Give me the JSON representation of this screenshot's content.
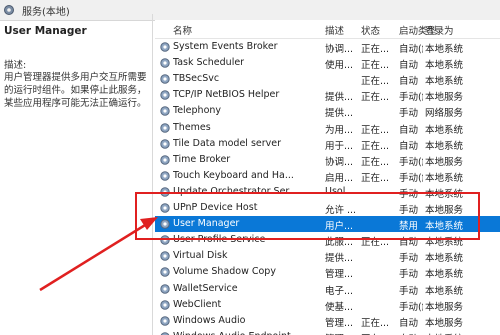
{
  "window": {
    "title": "服务(本地)"
  },
  "details": {
    "service_name": "User Manager",
    "description_label": "描述:",
    "description": "用户管理器提供多用户交互所需要的运行时组件。如果停止此服务，某些应用程序可能无法正确运行。"
  },
  "table": {
    "columns": [
      "名称",
      "描述",
      "状态",
      "启动类型",
      "登录为"
    ],
    "rows": [
      {
        "name": "System Events Broker",
        "desc": "协调...",
        "status": "正在...",
        "start": "自动(触发...",
        "logon": "本地系统"
      },
      {
        "name": "Task Scheduler",
        "desc": "使用...",
        "status": "正在...",
        "start": "自动",
        "logon": "本地系统"
      },
      {
        "name": "TBSecSvc",
        "desc": "",
        "status": "正在...",
        "start": "自动",
        "logon": "本地系统"
      },
      {
        "name": "TCP/IP NetBIOS Helper",
        "desc": "提供...",
        "status": "正在...",
        "start": "手动(触发...",
        "logon": "本地服务"
      },
      {
        "name": "Telephony",
        "desc": "提供...",
        "status": "",
        "start": "手动",
        "logon": "网络服务"
      },
      {
        "name": "Themes",
        "desc": "为用...",
        "status": "正在...",
        "start": "自动",
        "logon": "本地系统"
      },
      {
        "name": "Tile Data model server",
        "desc": "用于...",
        "status": "正在...",
        "start": "自动",
        "logon": "本地系统"
      },
      {
        "name": "Time Broker",
        "desc": "协调...",
        "status": "正在...",
        "start": "手动(触发...",
        "logon": "本地服务"
      },
      {
        "name": "Touch Keyboard and Ha...",
        "desc": "启用...",
        "status": "正在...",
        "start": "手动(触发...",
        "logon": "本地系统"
      },
      {
        "name": "Update Orchestrator Ser...",
        "desc": "Usol...",
        "status": "",
        "start": "手动",
        "logon": "本地系统"
      },
      {
        "name": "UPnP Device Host",
        "desc": "允许 ...",
        "status": "",
        "start": "手动",
        "logon": "本地服务"
      },
      {
        "name": "User Manager",
        "desc": "用户...",
        "status": "",
        "start": "禁用",
        "logon": "本地系统",
        "selected": true
      },
      {
        "name": "User Profile Service",
        "desc": "此服...",
        "status": "正在...",
        "start": "自动",
        "logon": "本地系统"
      },
      {
        "name": "Virtual Disk",
        "desc": "提供...",
        "status": "",
        "start": "手动",
        "logon": "本地系统"
      },
      {
        "name": "Volume Shadow Copy",
        "desc": "管理...",
        "status": "",
        "start": "手动",
        "logon": "本地系统"
      },
      {
        "name": "WalletService",
        "desc": "电子...",
        "status": "",
        "start": "手动",
        "logon": "本地系统"
      },
      {
        "name": "WebClient",
        "desc": "使基...",
        "status": "",
        "start": "手动(触发...",
        "logon": "本地服务"
      },
      {
        "name": "Windows Audio",
        "desc": "管理...",
        "status": "正在...",
        "start": "自动",
        "logon": "本地服务"
      },
      {
        "name": "Windows Audio Endpoint...",
        "desc": "管理 ...",
        "status": "正在...",
        "start": "自动",
        "logon": "本地系统"
      }
    ]
  },
  "colors": {
    "selection": "#0a78d7",
    "annotation": "#e02020"
  }
}
